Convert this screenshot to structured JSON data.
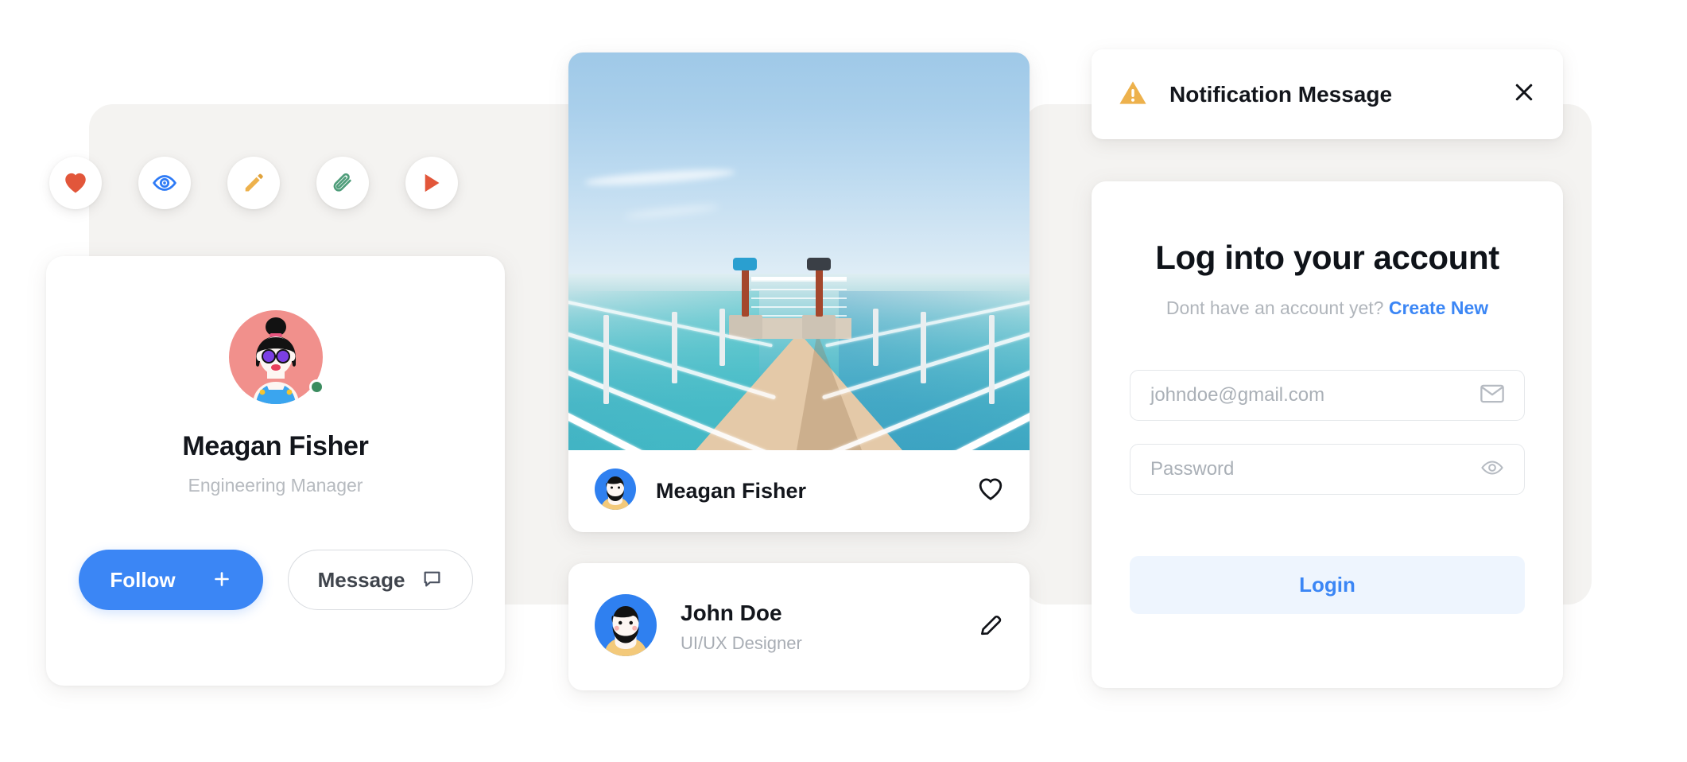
{
  "action_icons": [
    {
      "name": "heart-icon",
      "label": "Like",
      "color": "#e2563a"
    },
    {
      "name": "eye-icon",
      "label": "View",
      "color": "#2e7bf6"
    },
    {
      "name": "pencil-icon",
      "label": "Edit",
      "color": "#edb14c"
    },
    {
      "name": "paperclip-icon",
      "label": "Attach",
      "color": "#4f9d7a"
    },
    {
      "name": "play-icon",
      "label": "Play",
      "color": "#e2563a"
    }
  ],
  "profile_card": {
    "name": "Meagan Fisher",
    "role": "Engineering Manager",
    "status": "online",
    "status_color": "#3b8c5f",
    "follow_label": "Follow",
    "message_label": "Message",
    "follow_color": "#3b86f5"
  },
  "photo_card": {
    "image_alt": "Wooden pier with white railings over turquoise ocean",
    "username": "Meagan Fisher",
    "favorite_state": "not-favorited"
  },
  "person_card": {
    "name": "John Doe",
    "role": "UI/UX Designer"
  },
  "notification": {
    "message": "Notification Message",
    "severity": "warning",
    "severity_color": "#edb14c"
  },
  "login": {
    "title": "Log into your account",
    "subtitle_text": "Dont have an account yet?",
    "create_link": "Create New",
    "email_placeholder": "johndoe@gmail.com",
    "password_placeholder": "Password",
    "login_label": "Login",
    "accent_color": "#3b86f5"
  }
}
